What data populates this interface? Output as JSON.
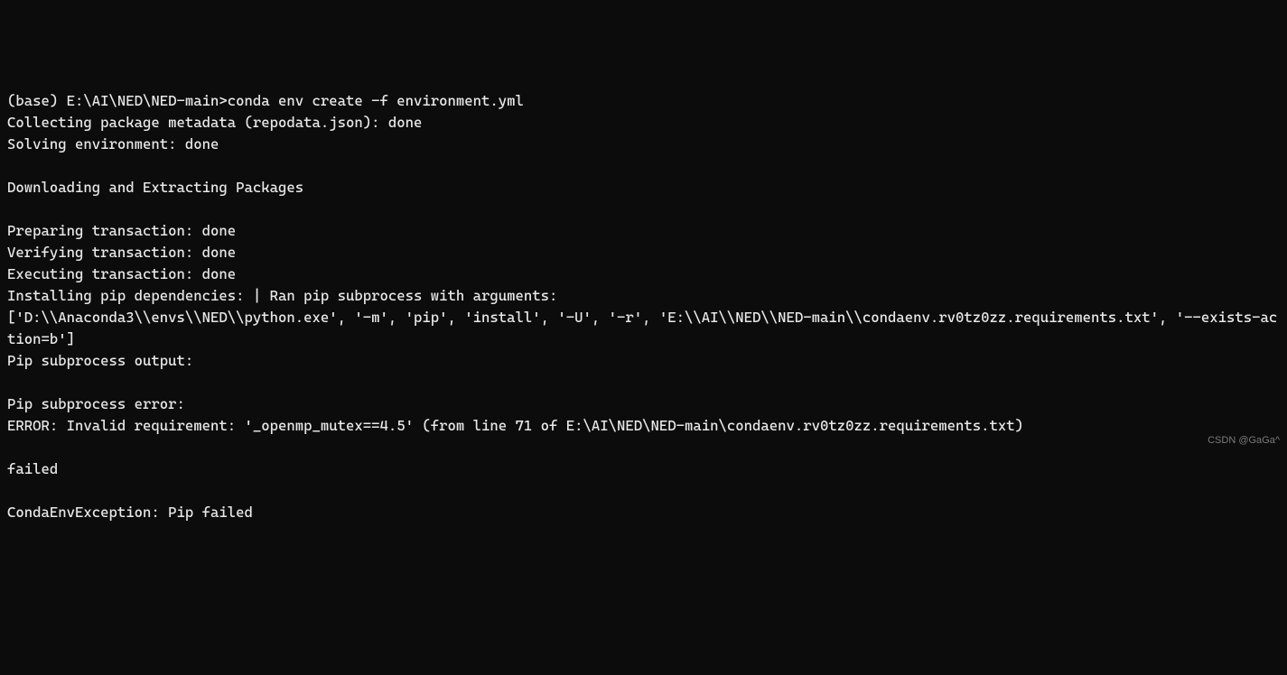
{
  "terminal": {
    "prompt_env": "(base) ",
    "prompt_path": "E:\\AI\\NED\\NED-main>",
    "command": "conda env create -f environment.yml",
    "line_collecting": "Collecting package metadata (repodata.json): done",
    "line_solving": "Solving environment: done",
    "line_downloading": "Downloading and Extracting Packages",
    "line_preparing": "Preparing transaction: done",
    "line_verifying": "Verifying transaction: done",
    "line_executing": "Executing transaction: done",
    "line_installing": "Installing pip dependencies: | Ran pip subprocess with arguments:",
    "line_args": "['D:\\\\Anaconda3\\\\envs\\\\NED\\\\python.exe', '-m', 'pip', 'install', '-U', '-r', 'E:\\\\AI\\\\NED\\\\NED-main\\\\condaenv.rv0tz0zz.requirements.txt', '--exists-action=b']",
    "line_pip_output": "Pip subprocess output:",
    "line_pip_error": "Pip subprocess error:",
    "line_error_msg": "ERROR: Invalid requirement: '_openmp_mutex==4.5' (from line 71 of E:\\AI\\NED\\NED-main\\condaenv.rv0tz0zz.requirements.txt)",
    "line_failed": "failed",
    "line_exception": "CondaEnvException: Pip failed"
  },
  "watermark": "CSDN @GaGa^"
}
